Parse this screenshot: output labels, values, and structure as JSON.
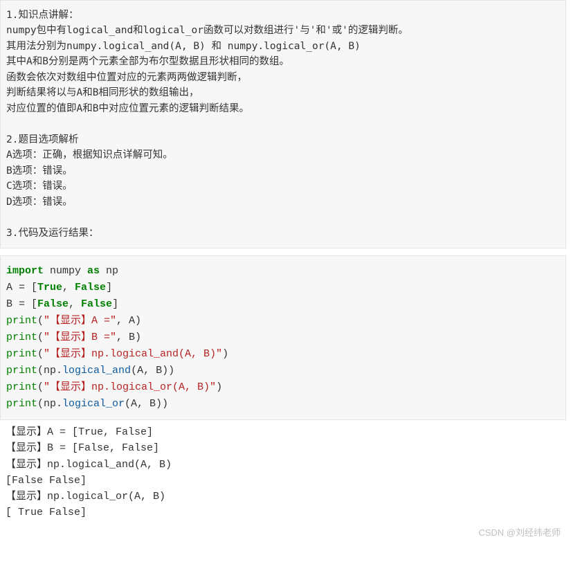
{
  "explanation": {
    "heading1": "1.知识点讲解：",
    "line1": "numpy包中有logical_and和logical_or函数可以对数组进行'与'和'或'的逻辑判断。",
    "line2": "其用法分别为numpy.logical_and(A, B) 和 numpy.logical_or(A, B)",
    "line3": "其中A和B分别是两个元素全部为布尔型数据且形状相同的数组。",
    "line4": "函数会依次对数组中位置对应的元素两两做逻辑判断，",
    "line5": "判断结果将以与A和B相同形状的数组输出，",
    "line6": "对应位置的值即A和B中对应位置元素的逻辑判断结果。",
    "heading2": "2.题目选项解析",
    "optA": "A选项：正确，根据知识点详解可知。",
    "optB": "B选项：错误。",
    "optC": "C选项：错误。",
    "optD": "D选项：错误。",
    "heading3": "3.代码及运行结果："
  },
  "code": {
    "kw_import": "import",
    "mod_numpy": " numpy ",
    "kw_as": "as",
    "mod_np": " np",
    "line_a_pre": "A = [",
    "true": "True",
    "sep": ", ",
    "false": "False",
    "brk": "]",
    "line_b_pre": "B = [",
    "print": "print",
    "lp": "(",
    "rp": ")",
    "str_a": "\"【显示】A =\"",
    "comma_a": ", A)",
    "str_b": "\"【显示】B =\"",
    "comma_b": ", B)",
    "str_and": "\"【显示】np.logical_and(A, B)\"",
    "np_pre": "(np.",
    "logical_and": "logical_and",
    "call_args": "(A, B))",
    "str_or": "\"【显示】np.logical_or(A, B)\"",
    "logical_or": "logical_or"
  },
  "output": {
    "l1": "【显示】A = [True, False]",
    "l2": "【显示】B = [False, False]",
    "l3": "【显示】np.logical_and(A, B)",
    "l4": "[False False]",
    "l5": "【显示】np.logical_or(A, B)",
    "l6": "[ True False]"
  },
  "watermark": "CSDN @刘经纬老师"
}
